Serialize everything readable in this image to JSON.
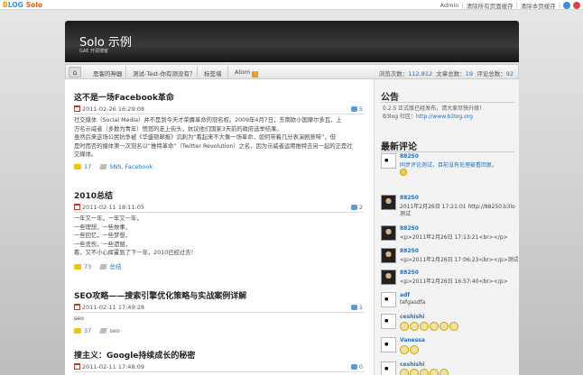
{
  "topbar": {
    "logo_b": "B",
    "logo_rest": "LOG",
    "logo_solo": "Solo",
    "admin": "Admin",
    "clear_all": "清除所有页面缓存",
    "clear_page": "清除本页缓存"
  },
  "header": {
    "title": "Solo 示例",
    "subtitle": "GAE 开源博客"
  },
  "nav": {
    "items": [
      "思客的神器",
      "测试-Test-你有测没有？",
      "标签墙",
      "Atom"
    ],
    "stats": {
      "views_label": "浏览次数：",
      "views": "112,812",
      "articles_label": "文章总数：",
      "articles": "19",
      "comments_label": "评论总数：",
      "comments": "92"
    }
  },
  "posts": [
    {
      "title": "这不是一场Facebook革命",
      "date": "2011-02-26 16:29:08",
      "comments": "5",
      "lines": [
        "社交媒体（Social Media）并不是到今天才荣膺革命的冠名权。2009年4月7日，东南欧小国摩尔多瓦，上",
        "万名示威者（多数为青年）愤怒的走上街头，抗议他们国家3天前的政府选举结果。",
        "虽然后来这场公民抗争被《华盛顿邮报》讥刺为“看起来不大像一场革命，如何带着几分表演剧意味”，但",
        "是时而否的媒体第一次冠名以“推特革命”（Twitter Revolution）之名，因为示威者运用推特去另一起的正是社",
        "交媒体。"
      ],
      "views": "17",
      "tags": "SNS, Facebook"
    },
    {
      "title": "2010总结",
      "date": "2011-02-11 18:11:05",
      "comments": "2",
      "lines": [
        "一年又一年，一年又一年，",
        "一些理想，一些故事，",
        "一些回忆，一些梦想，",
        "一些悲伤，一些遗憾，",
        "看，又不小心挥霍到了下一年，2010已经过去！"
      ],
      "views": "73",
      "tags": "总结"
    },
    {
      "title": "SEO攻略——搜索引擎优化策略与实战案例详解",
      "date": "2011-02-11 17:49:28",
      "comments": "1",
      "lines": [
        "seo"
      ],
      "views": "37",
      "tags": "seo"
    },
    {
      "title": "搜主义：Google持续成长的秘密",
      "date": "2011-02-11 17:48:09",
      "comments": "0",
      "lines": [],
      "views": "",
      "tags": ""
    }
  ],
  "sidebar": {
    "notice_title": "公告",
    "notice_line1": "0.2.5 正式版已经发布，请大家尽快升级！",
    "notice_line2_prefix": "B3log 社区：",
    "notice_link": "http://www.b3log.org",
    "recent_title": "最新评论",
    "comments": [
      {
        "name": "88250",
        "text": "同步评论测试，目前没有处理被看回复。",
        "link": true,
        "avatar": "panda"
      },
      {
        "name": "88250",
        "text": "2011年2月26日 17:21:01 http://88250.b3lo",
        "link": false,
        "avatar": "dark"
      },
      {
        "name": "88250",
        "text": "<p>2011年2月26日 17:13:21<br></p>",
        "link": false,
        "avatar": "dark"
      },
      {
        "name": "88250",
        "text": "<p>2011年2月26日 17:06:23<br></p>测试",
        "link": false,
        "avatar": "dark"
      },
      {
        "name": "88250",
        "text": "<p>2011年2月26日 16:57:40<br></p>",
        "link": false,
        "avatar": "dark"
      },
      {
        "name": "adf",
        "text": "tefgasdfa",
        "link": false,
        "avatar": "panda"
      },
      {
        "name": "ceshishi",
        "text": "",
        "link": false,
        "avatar": "panda"
      },
      {
        "name": "Vanessa",
        "text": "",
        "link": false,
        "avatar": "panda"
      },
      {
        "name": "ceshishi",
        "text": "",
        "link": false,
        "avatar": "panda"
      }
    ],
    "extra_line": "测试"
  }
}
